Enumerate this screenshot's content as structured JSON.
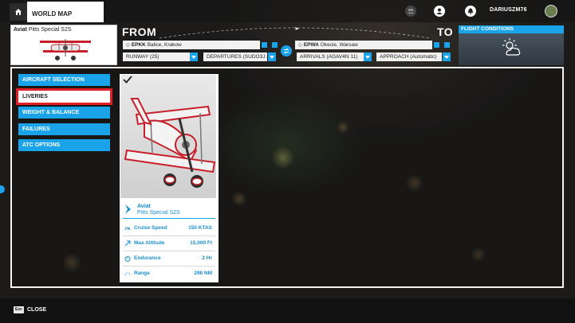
{
  "topbar": {
    "tab_label": "WORLD MAP",
    "username": "DARIUSZM76"
  },
  "aircraft_card": {
    "maker": "Aviat",
    "model": "Pitts Special S2S"
  },
  "flight_plan": {
    "from_label": "FROM",
    "to_label": "TO",
    "departure": {
      "code": "EPKK",
      "name": "Balice, Krakow"
    },
    "arrival": {
      "code": "EPWA",
      "name": "Okecie, Warsaw"
    },
    "runway": "RUNWAY (25)",
    "departures": "DEPARTURES (SUDO3J 25)",
    "arrivals": "ARRIVALS (AGAV4N 11)",
    "approach": "APPROACH (Automatic)"
  },
  "flight_conditions": {
    "title": "FLIGHT CONDITIONS",
    "icon": "sun-cloud-icon"
  },
  "menu": {
    "items": [
      {
        "label": "AIRCRAFT SELECTION",
        "selected": false
      },
      {
        "label": "LIVERIES",
        "selected": true
      },
      {
        "label": "WEIGHT & BALANCE",
        "selected": false
      },
      {
        "label": "FAILURES",
        "selected": false
      },
      {
        "label": "ATC OPTIONS",
        "selected": false
      }
    ]
  },
  "livery_card": {
    "maker": "Aviat",
    "model": "Pitts Special S2S",
    "checked": true,
    "stats": [
      {
        "label": "Cruise Speed",
        "value": "150 KTAS",
        "icon": "speedometer-icon"
      },
      {
        "label": "Max Altitude",
        "value": "15,000 Ft",
        "icon": "altitude-arrow-icon"
      },
      {
        "label": "Endurance",
        "value": "2 Hr",
        "icon": "stopwatch-icon"
      },
      {
        "label": "Range",
        "value": "298 NM",
        "icon": "range-gauge-icon"
      }
    ]
  },
  "bottombar": {
    "esc_key": "Esc",
    "close_label": "CLOSE"
  },
  "colors": {
    "accent": "#1aa3e8",
    "highlight_border": "#e11e26"
  }
}
